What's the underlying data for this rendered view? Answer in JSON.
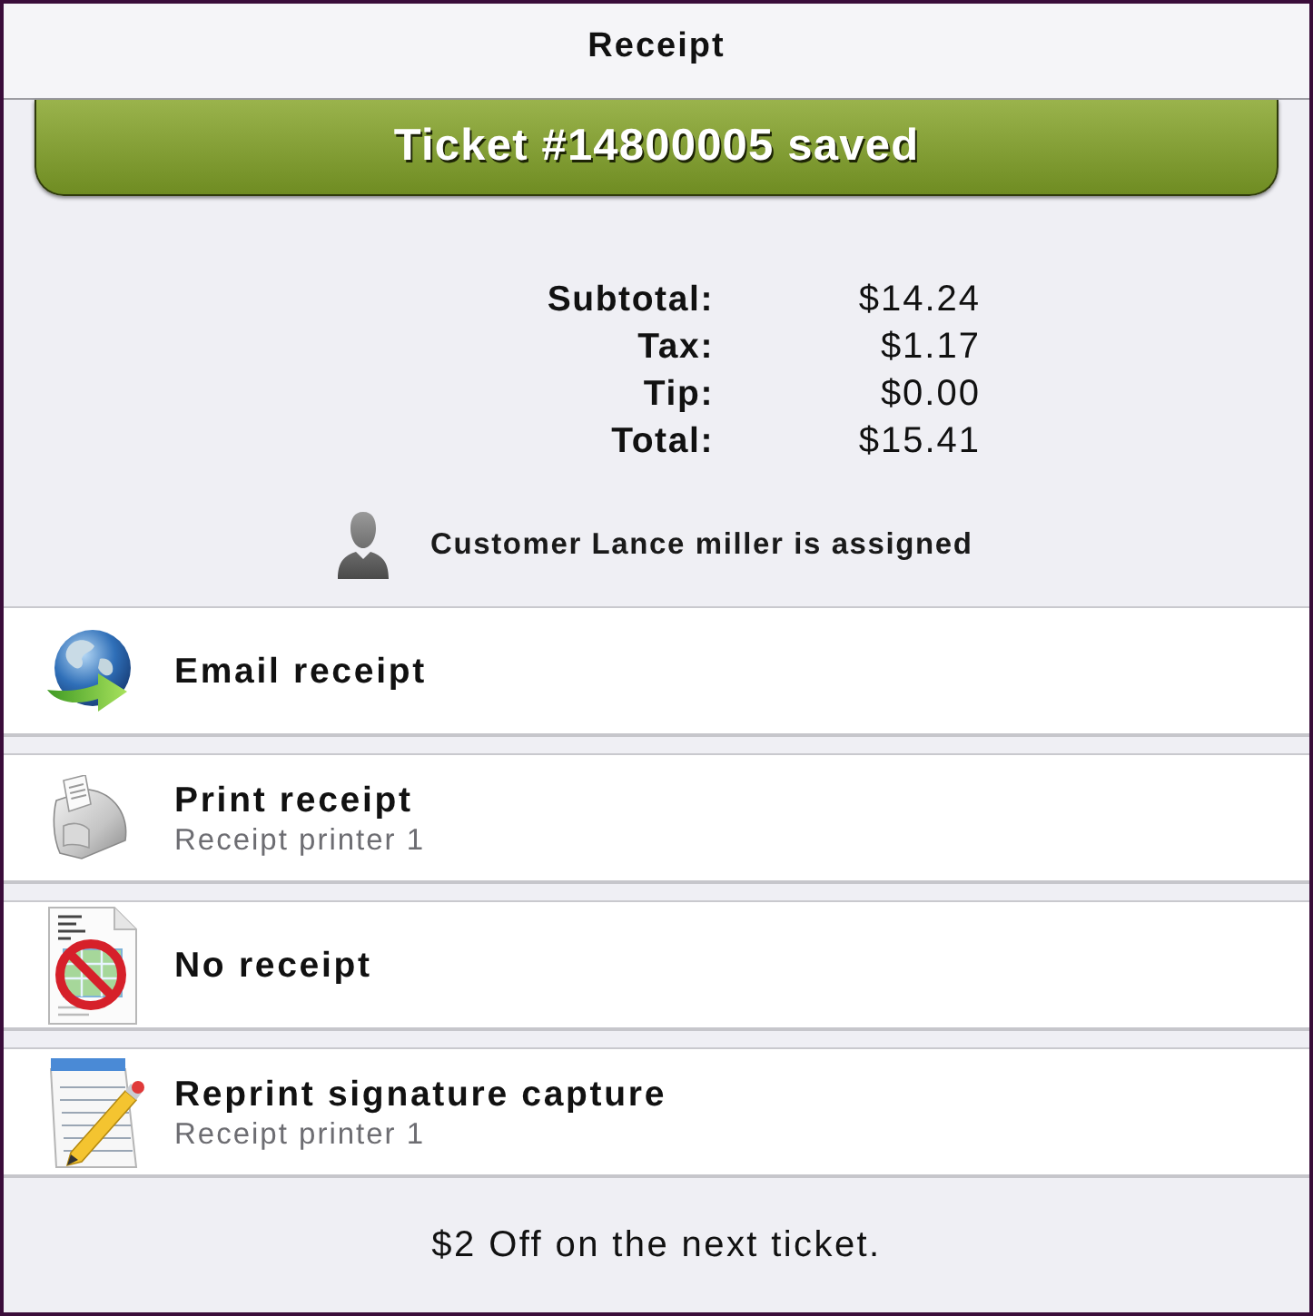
{
  "header": {
    "title": "Receipt"
  },
  "banner": {
    "text": "Ticket #14800005 saved"
  },
  "totals": [
    {
      "label": "Subtotal:",
      "value": "$14.24"
    },
    {
      "label": "Tax:",
      "value": "$1.17"
    },
    {
      "label": "Tip:",
      "value": "$0.00"
    },
    {
      "label": "Total:",
      "value": "$15.41"
    }
  ],
  "customer": {
    "text": "Customer Lance miller is assigned"
  },
  "options": [
    {
      "kind": "email",
      "title": "Email receipt"
    },
    {
      "kind": "print",
      "title": "Print receipt",
      "subtitle": "Receipt printer 1"
    },
    {
      "kind": "none",
      "title": "No receipt"
    },
    {
      "kind": "signature",
      "title": "Reprint signature capture",
      "subtitle": "Receipt printer 1"
    }
  ],
  "footer": {
    "text": "$2 Off on the next ticket."
  }
}
